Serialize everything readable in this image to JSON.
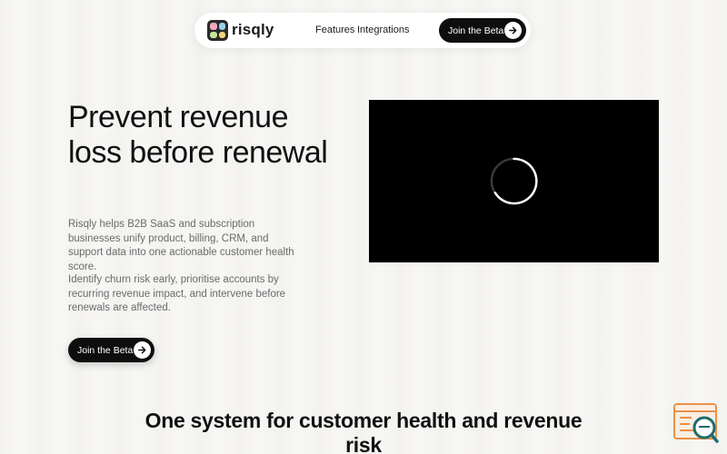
{
  "brand": {
    "name": "risqly"
  },
  "nav": {
    "links": [
      {
        "label": "Features"
      },
      {
        "label": "Integrations"
      }
    ],
    "cta_label": "Join the Beta"
  },
  "hero": {
    "title": "Prevent revenue loss before renewal",
    "paragraph1": "Risqly helps B2B SaaS and subscription businesses unify product, billing, CRM, and support data into one actionable customer health score.",
    "paragraph2": "Identify churn risk early, prioritise accounts by recurring revenue impact, and intervene before renewals are affected.",
    "cta_label": "Join the Beta"
  },
  "video": {
    "state_icon": "loading-spinner-icon"
  },
  "section": {
    "title": "One system for customer health and revenue risk"
  },
  "colors": {
    "background": "#f3f2ef",
    "dark": "#0e0e0e",
    "badge_accent": "#e8914a",
    "badge_teal": "#1f6b6b"
  }
}
